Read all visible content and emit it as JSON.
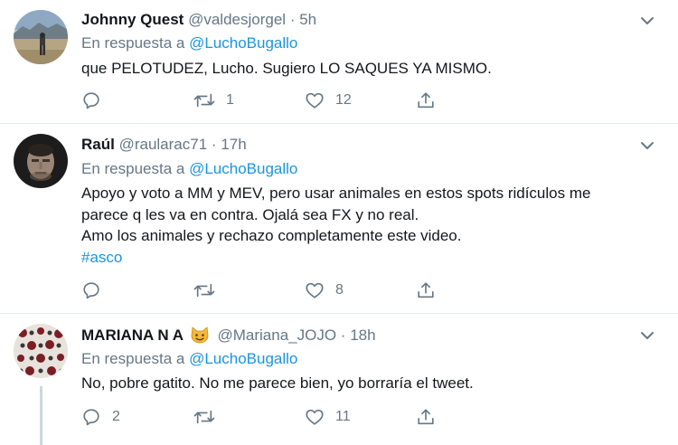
{
  "tweets": [
    {
      "name": "Johnny Quest",
      "handle": "@valdesjorgel",
      "dot": "·",
      "time": "5h",
      "reply_prefix": "En respuesta a",
      "reply_to": "@LuchoBugallo",
      "lines": [
        "que PELOTUDEZ, Lucho. Sugiero LO SAQUES YA MISMO."
      ],
      "replies": "",
      "retweets": "1",
      "likes": "12"
    },
    {
      "name": "Raúl",
      "handle": "@raularac71",
      "dot": "·",
      "time": "17h",
      "reply_prefix": "En respuesta a",
      "reply_to": "@LuchoBugallo",
      "lines": [
        "Apoyo y voto a MM y MEV, pero usar animales en estos spots ridículos me",
        "parece q les va en contra.  Ojalá sea FX y no real.",
        "Amo los animales y rechazo completamente este video."
      ],
      "hashtag": "#asco",
      "replies": "",
      "retweets": "",
      "likes": "8"
    },
    {
      "name": "MARIANA N A",
      "name_emoji": "cat-face-emoji",
      "handle": "@Mariana_JOJO",
      "dot": "·",
      "time": "18h",
      "reply_prefix": "En respuesta a",
      "reply_to": "@LuchoBugallo",
      "lines": [
        "No, pobre gatito. No me parece bien, yo borraría el tweet."
      ],
      "replies": "2",
      "retweets": "",
      "likes": "11"
    }
  ],
  "colors": {
    "link": "#1b95e0",
    "secondary": "#657786",
    "text": "#14171a",
    "divider": "#e6ecf0",
    "thread_line": "#ccd6dd"
  },
  "icons": {
    "reply": "reply-icon",
    "retweet": "retweet-icon",
    "like": "heart-icon",
    "share": "share-icon",
    "menu": "chevron-down-icon"
  }
}
